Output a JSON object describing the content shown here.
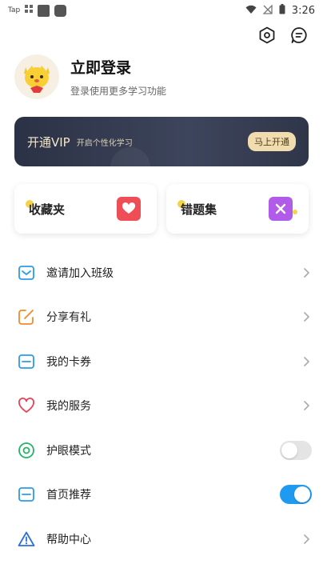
{
  "status_bar": {
    "app_label": "Tap",
    "time": "3:26"
  },
  "profile": {
    "title": "立即登录",
    "subtitle": "登录使用更多学习功能"
  },
  "vip": {
    "title": "开通VIP",
    "desc": "开启个性化学习",
    "button": "马上开通"
  },
  "cards": [
    {
      "label": "收藏夹",
      "icon": "favorites-folder-icon"
    },
    {
      "label": "错题集",
      "icon": "wrong-questions-icon"
    }
  ],
  "menu": [
    {
      "label": "邀请加入班级",
      "icon": "invite-class-icon",
      "color": "#2c9be8",
      "control": "chevron"
    },
    {
      "label": "分享有礼",
      "icon": "share-gift-icon",
      "color": "#f08a2b",
      "control": "chevron"
    },
    {
      "label": "我的卡券",
      "icon": "coupon-card-icon",
      "color": "#2c9be8",
      "control": "chevron"
    },
    {
      "label": "我的服务",
      "icon": "heart-service-icon",
      "color": "#e8425a",
      "control": "chevron"
    },
    {
      "label": "护眼模式",
      "icon": "eye-protection-icon",
      "color": "#25b36a",
      "control": "toggle",
      "on": false
    },
    {
      "label": "首页推荐",
      "icon": "home-recommend-icon",
      "color": "#2c9be8",
      "control": "toggle",
      "on": true
    },
    {
      "label": "帮助中心",
      "icon": "help-center-icon",
      "color": "#2b6fd8",
      "control": "chevron"
    }
  ],
  "colors": {
    "vip_bg": "#2c3245",
    "vip_button": "#f0dcae",
    "toggle_on": "#1e9af0",
    "toggle_off": "#e4e4e4"
  }
}
